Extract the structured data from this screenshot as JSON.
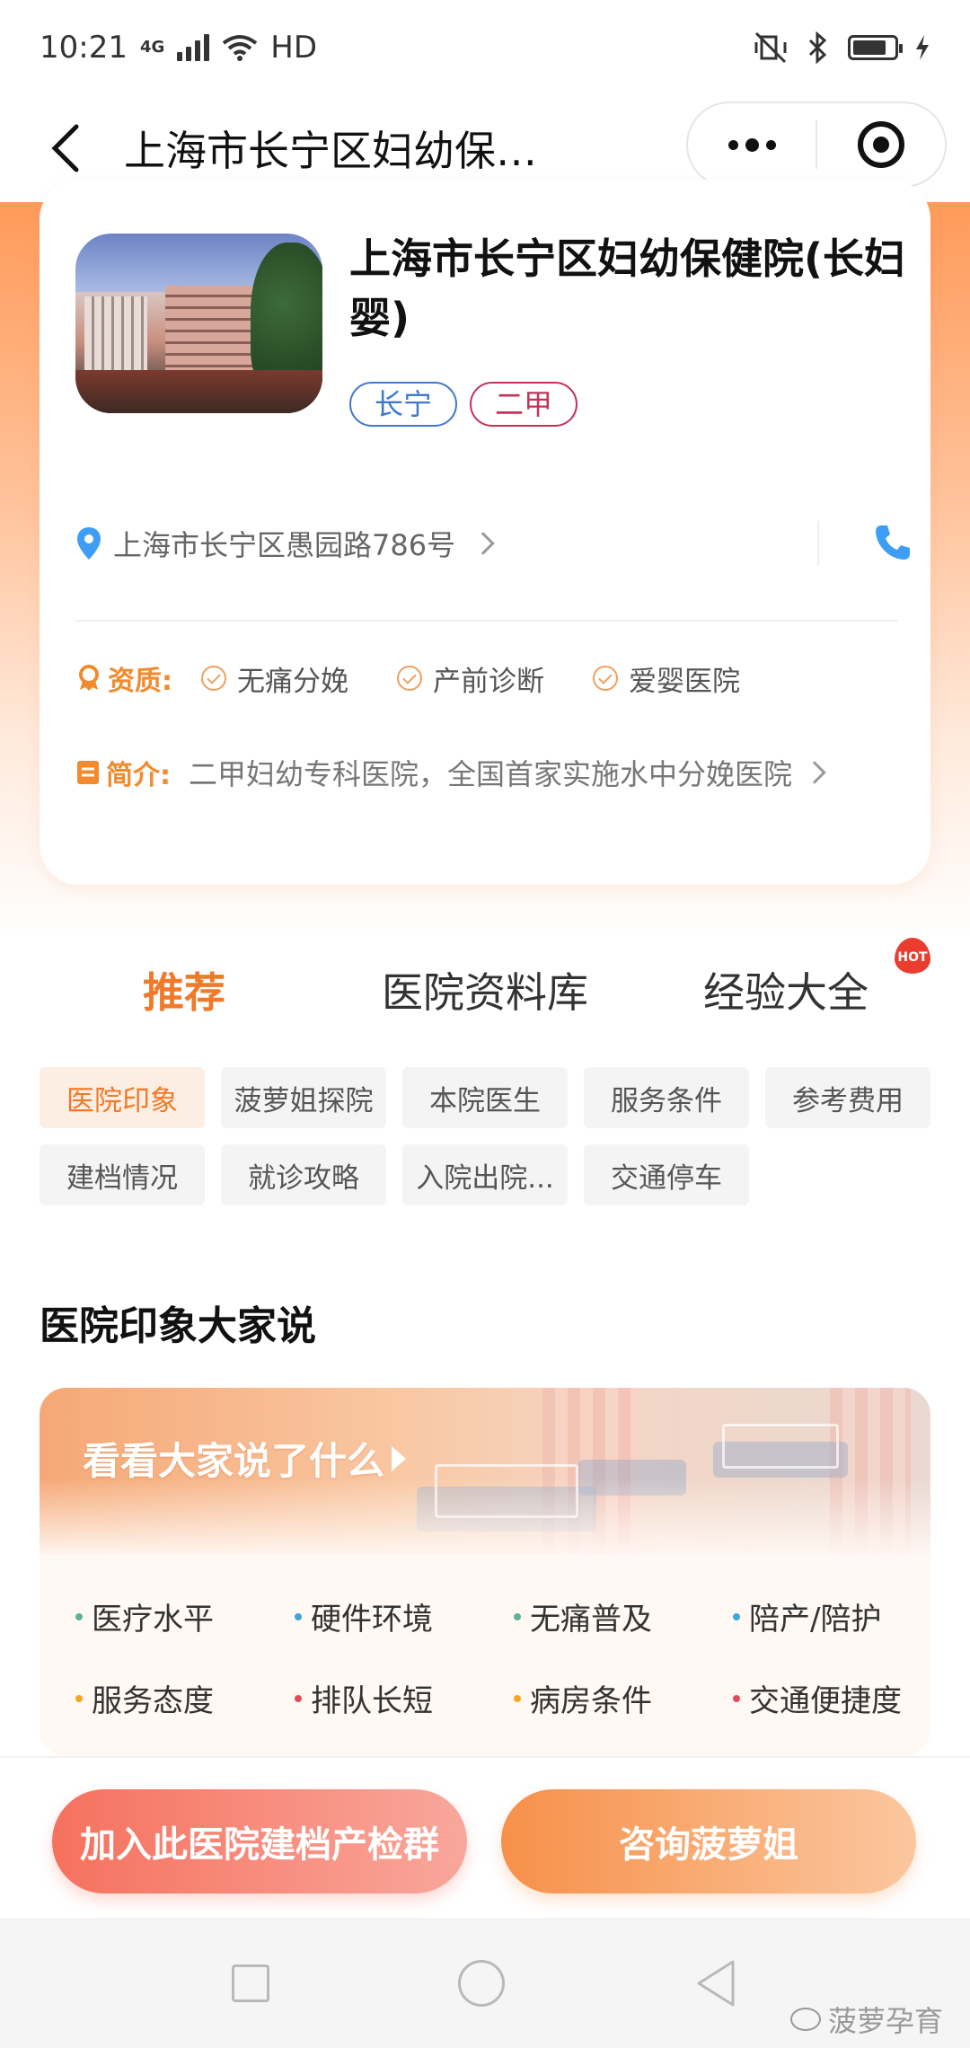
{
  "status_bar": {
    "time": "10:21",
    "network": "4G",
    "hd": "HD"
  },
  "nav": {
    "title": "上海市长宁区妇幼保…"
  },
  "hospital": {
    "name": "上海市长宁区妇幼保健院(长妇婴)",
    "tags": [
      "长宁",
      "二甲"
    ],
    "address": "上海市长宁区愚园路786号",
    "qualification_label": "资质:",
    "qualifications": [
      "无痛分娩",
      "产前诊断",
      "爱婴医院"
    ],
    "intro_label": "简介:",
    "intro": "二甲妇幼专科医院，全国首家实施水中分娩医院"
  },
  "main_tabs": {
    "items": [
      "推荐",
      "医院资料库",
      "经验大全"
    ],
    "hot_badge": "HOT"
  },
  "chips": [
    "医院印象",
    "菠萝姐探院",
    "本院医生",
    "服务条件",
    "参考费用",
    "建档情况",
    "就诊攻略",
    "入院出院...",
    "交通停车"
  ],
  "section": {
    "title": "医院印象大家说",
    "banner_link": "看看大家说了什么",
    "topics": [
      {
        "label": "医疗水平",
        "dot": "#5bb59b"
      },
      {
        "label": "硬件环境",
        "dot": "#3aa7d8"
      },
      {
        "label": "无痛普及",
        "dot": "#5bb59b"
      },
      {
        "label": "陪产/陪护",
        "dot": "#3aa7d8"
      },
      {
        "label": "服务态度",
        "dot": "#f5a623"
      },
      {
        "label": "排队长短",
        "dot": "#e34b5b"
      },
      {
        "label": "病房条件",
        "dot": "#f5a623"
      },
      {
        "label": "交通便捷度",
        "dot": "#e34b5b"
      }
    ]
  },
  "actions": {
    "join_group": "加入此医院建档产检群",
    "consult": "咨询菠萝姐"
  },
  "watermark": "菠萝孕育",
  "colors": {
    "accent": "#f07a2a",
    "tag_blue": "#3f79c9",
    "tag_red": "#c2335a"
  }
}
